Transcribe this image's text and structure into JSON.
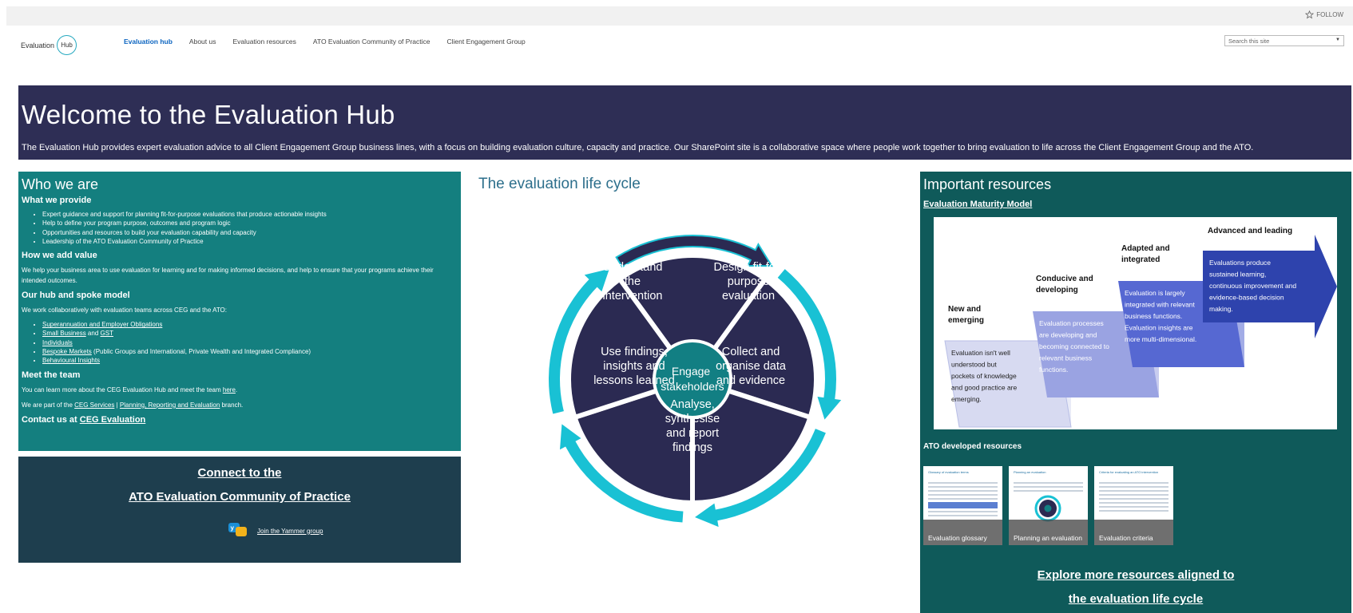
{
  "topbar": {
    "follow_label": "FOLLOW"
  },
  "logo": {
    "word": "Evaluation",
    "ring": "Hub"
  },
  "nav": [
    "Evaluation hub",
    "About us",
    "Evaluation resources",
    "ATO Evaluation Community of Practice",
    "Client Engagement Group"
  ],
  "search": {
    "placeholder": "Search this site"
  },
  "hero": {
    "title": "Welcome to the Evaluation Hub",
    "text": "The Evaluation Hub provides expert evaluation advice to all Client Engagement Group business lines, with a focus on building evaluation culture, capacity and practice. Our SharePoint site is a collaborative space where people work together to bring evaluation to life across the Client Engagement Group and the ATO."
  },
  "who": {
    "title": "Who we are",
    "provide_heading": "What we provide",
    "provide_items": [
      "Expert guidance and support for planning fit-for-purpose evaluations that produce actionable insights",
      "Help to define your program purpose, outcomes and program logic",
      "Opportunities and resources to build your evaluation capability and capacity",
      "Leadership of the ATO Evaluation Community of Practice"
    ],
    "value_heading": "How we add value",
    "value_text": "We help your business area to use evaluation for learning and for making informed decisions, and help to ensure that your programs achieve their intended outcomes.",
    "hub_heading": "Our hub and spoke model",
    "hub_text": "We work collaboratively with evaluation teams across CEG and the ATO:",
    "hub_links": {
      "super": "Superannuation and Employer Obligations",
      "small": "Small Business",
      "and": "and",
      "gst": "GST",
      "individuals": "Individuals",
      "bespoke": "Bespoke Markets",
      "bespoke_rest": "(Public Groups and International, Private Wealth and Integrated Compliance)",
      "behavioural": "Behavioural Insights"
    },
    "team_heading": "Meet the team",
    "team_text": "You can learn more about the CEG Evaluation Hub and meet the team",
    "team_link": "here",
    "team_end": ".",
    "part_text": "We are part of the",
    "part_link1": "CEG Services",
    "part_sep": "|",
    "part_link2": "Planning, Reporting and Evaluation",
    "part_end": "branch.",
    "contact_text": "Contact us at",
    "contact_link": "CEG Evaluation"
  },
  "connect": {
    "line1": "Connect to the",
    "line2": "ATO Evaluation Community of Practice",
    "yammer": "Join the Yammer group"
  },
  "lifecycle": {
    "title": "The evaluation life cycle",
    "center": [
      "Engage",
      "stakeholders"
    ],
    "segments": [
      [
        "Understand",
        "the",
        "intervention"
      ],
      [
        "Design fit-for-",
        "purpose",
        "evaluation"
      ],
      [
        "Collect and",
        "organise data",
        "and evidence"
      ],
      [
        "Analyse,",
        "synthesise",
        "and report",
        "findings"
      ],
      [
        "Use findings,",
        "insights and",
        "lessons learned"
      ]
    ]
  },
  "resources": {
    "title": "Important resources",
    "emm_link": "Evaluation Maturity Model",
    "maturity": {
      "stages": [
        {
          "title": [
            "New and",
            "emerging"
          ],
          "text": [
            "Evaluation isn't well",
            "understood but",
            "pockets of knowledge",
            "and good practice are",
            "emerging."
          ]
        },
        {
          "title": [
            "Conducive and",
            "developing"
          ],
          "text": [
            "Evaluation processes",
            "are developing and",
            "becoming connected to",
            "relevant business",
            "functions."
          ]
        },
        {
          "title": [
            "Adapted and",
            "integrated"
          ],
          "text": [
            "Evaluation is largely",
            "integrated with relevant",
            "business functions.",
            "Evaluation insights are",
            "more multi-dimensional."
          ]
        },
        {
          "title": [
            "Advanced and leading"
          ],
          "text": [
            "Evaluations produce",
            "sustained learning,",
            "continuous improvement and",
            "evidence-based decision",
            "making."
          ]
        }
      ]
    },
    "ato_dev_heading": "ATO developed resources",
    "thumbs": [
      "Evaluation glossary",
      "Planning an evaluation",
      "Evaluation criteria"
    ],
    "thumb_titles": [
      "Glossary of evaluation terms",
      "Planning an evaluation",
      "Criteria for evaluating an ATO intervention"
    ],
    "explore1": "Explore more resources aligned to",
    "explore2": "the evaluation life cycle"
  },
  "colors": {
    "hero_bg": "#2e2e55",
    "who_bg": "#147f7f",
    "connect_bg": "#1e3e4e",
    "resources_bg": "#0f5a5a",
    "cycle_ring": "#19c1d4",
    "cycle_navy": "#2b2a52",
    "cycle_center": "#127f83",
    "nav_active": "#0b64c0"
  }
}
